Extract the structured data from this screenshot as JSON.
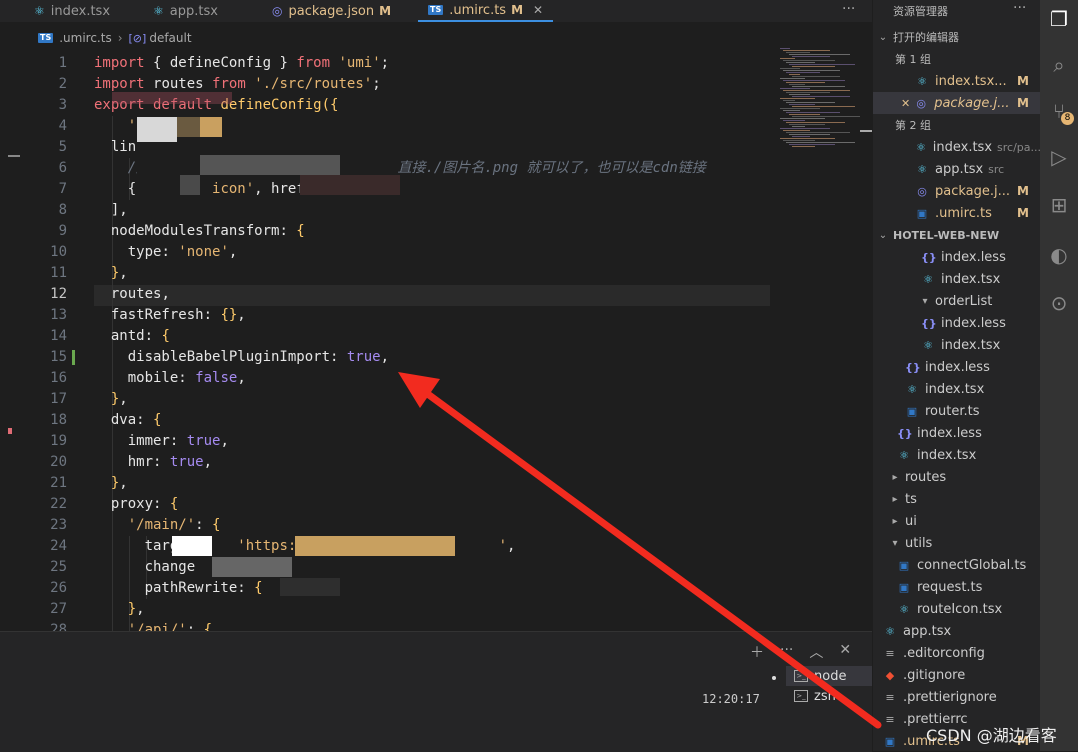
{
  "tabs": [
    {
      "label": "index.tsx",
      "modified": "",
      "active": false
    },
    {
      "label": "app.tsx",
      "modified": "",
      "active": false
    },
    {
      "label": "package.json",
      "modified": "M",
      "active": false
    },
    {
      "label": ".umirc.ts",
      "modified": "M",
      "active": true
    }
  ],
  "breadcrumb": {
    "file": ".umirc.ts",
    "symbol": "default"
  },
  "code": {
    "line_numbers": [
      "1",
      "2",
      "3",
      "4",
      "5",
      "6",
      "7",
      "8",
      "9",
      "10",
      "11",
      "12",
      "13",
      "14",
      "15",
      "16",
      "17",
      "18",
      "19",
      "20",
      "21",
      "22",
      "23",
      "24",
      "25",
      "26",
      "27",
      "28"
    ],
    "current_line": "12",
    "lines_text": {
      "l1": "import { defineConfig } from 'umi';",
      "l2": "import routes from './src/routes';",
      "l3": "export default defineConfig({",
      "l4": "  ",
      "l5": "  lin",
      "l6": "    // h",
      "l6b": "直接./图片名.png 就可以了，也可以是cdn链接",
      "l7": "    { r",
      "l7b": "icon', href:",
      "l8": "  ],",
      "l9": "  nodeModulesTransform: {",
      "l10": "    type: 'none',",
      "l11": "  },",
      "l12": "  routes,",
      "l13": "  fastRefresh: {},",
      "l14": "  antd: {",
      "l15": "    disableBabelPluginImport: true,",
      "l16": "    mobile: false,",
      "l17": "  },",
      "l18": "  dva: {",
      "l19": "    immer: true,",
      "l20": "    hmr: true,",
      "l21": "  },",
      "l22": "  proxy: {",
      "l23": "    '/main/': {",
      "l24": "      targ",
      "l24b": "https://o",
      "l25": "      change",
      "l26": "      pathRewrite: {",
      "l27": "    },",
      "l28": "    '/api/': {"
    }
  },
  "panel": {
    "time": "12:20:17",
    "terminals": [
      {
        "label": "node",
        "active": true
      },
      {
        "label": "zsh",
        "active": false
      }
    ]
  },
  "sidebar": {
    "title": "资源管理器",
    "open_editors_label": "打开的编辑器",
    "group1_label": "第 1 组",
    "group2_label": "第 2 组",
    "group1": [
      {
        "name": "index.tsx...",
        "mod": "M",
        "icon": "react-icon"
      },
      {
        "name": "package.j...",
        "mod": "M",
        "icon": "package-icon"
      }
    ],
    "group2": [
      {
        "name": "index.tsx",
        "sub": "src/pa...",
        "mod": "",
        "icon": "react-icon"
      },
      {
        "name": "app.tsx",
        "sub": "src",
        "mod": "",
        "icon": "react-icon"
      },
      {
        "name": "package.j...",
        "sub": "",
        "mod": "M",
        "icon": "package-icon"
      },
      {
        "name": ".umirc.ts",
        "sub": "",
        "mod": "M",
        "icon": "ts-icon"
      }
    ],
    "project_label": "HOTEL-WEB-NEW",
    "tree": [
      {
        "name": "index.less",
        "icon": "less"
      },
      {
        "name": "index.tsx",
        "icon": "react"
      },
      {
        "name": "orderList",
        "icon": "folder"
      },
      {
        "name": "index.less",
        "icon": "less"
      },
      {
        "name": "index.tsx",
        "icon": "react"
      },
      {
        "name": "index.less",
        "icon": "less"
      },
      {
        "name": "index.tsx",
        "icon": "react"
      },
      {
        "name": "router.ts",
        "icon": "ts"
      },
      {
        "name": "index.less",
        "icon": "less"
      },
      {
        "name": "index.tsx",
        "icon": "react"
      },
      {
        "name": "routes",
        "icon": "folder-closed"
      },
      {
        "name": "ts",
        "icon": "folder-closed"
      },
      {
        "name": "ui",
        "icon": "folder-closed"
      },
      {
        "name": "utils",
        "icon": "folder"
      },
      {
        "name": "connectGlobal.ts",
        "icon": "ts"
      },
      {
        "name": "request.ts",
        "icon": "ts"
      },
      {
        "name": "routeIcon.tsx",
        "icon": "react"
      },
      {
        "name": "app.tsx",
        "icon": "react"
      },
      {
        "name": ".editorconfig",
        "icon": "plain"
      },
      {
        "name": ".gitignore",
        "icon": "git"
      },
      {
        "name": ".prettierignore",
        "icon": "plain"
      },
      {
        "name": ".prettierrc",
        "icon": "plain"
      },
      {
        "name": ".umirc.ts",
        "icon": "ts",
        "mod": "M"
      }
    ]
  },
  "activity": {
    "badge": "8"
  },
  "watermark": "CSDN @湖边看客",
  "colors": {
    "arrow": "#f22b1f",
    "accent": "#3c8fe0",
    "modified": "#e2c08d"
  }
}
